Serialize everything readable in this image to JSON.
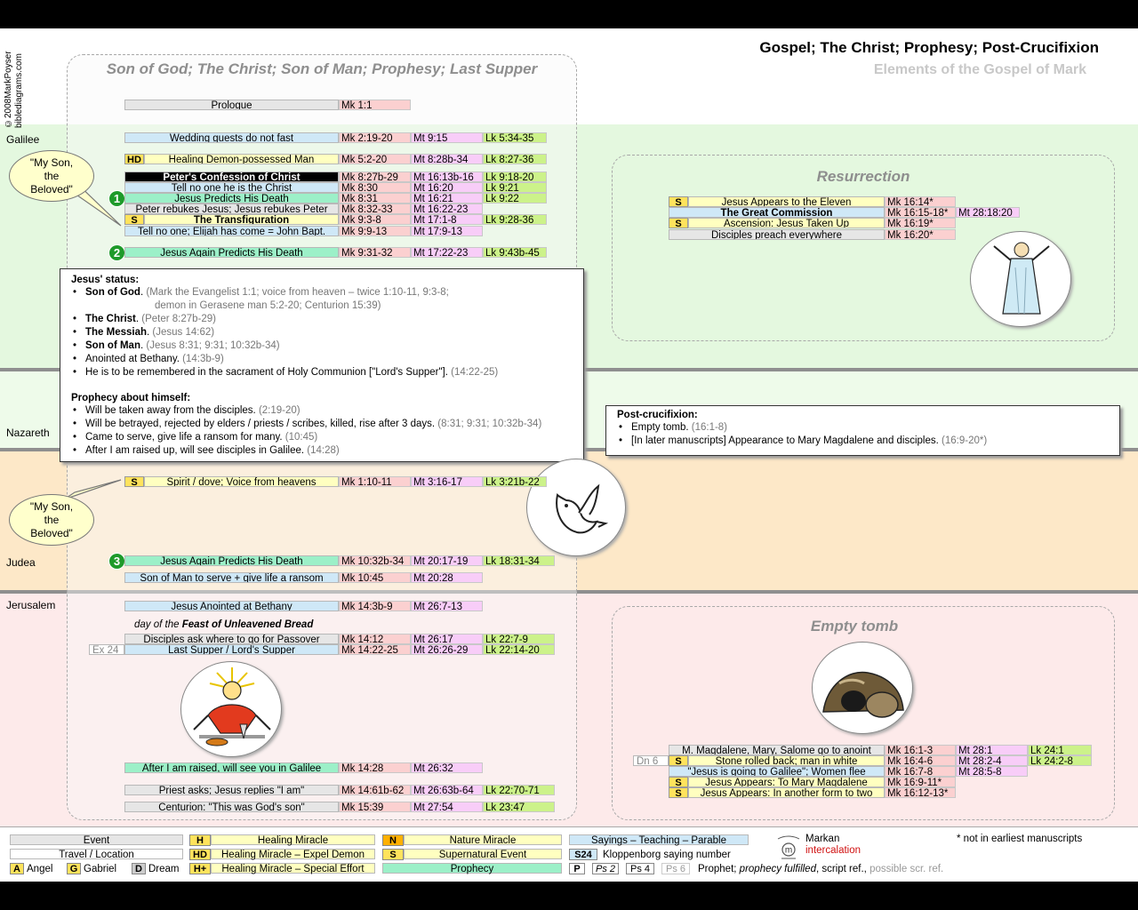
{
  "header": {
    "copyright": "©2008MarkPoyser\nbiblediagrams.com",
    "title": "Gospel; The Christ; Prophesy; Post-Crucifixion",
    "subtitle": "Elements of the Gospel of Mark"
  },
  "regions": {
    "galilee": "Galilee",
    "nazareth": "Nazareth",
    "judea": "Judea",
    "jerusalem": "Jerusalem"
  },
  "panels": {
    "main": "Son of God; The Christ; Son of Man; Prophesy; Last Supper",
    "resurrection": "Resurrection",
    "empty_tomb": "Empty tomb"
  },
  "bubbles": {
    "top": "\"My Son,\nthe\nBeloved\"",
    "bottom": "\"My Son,\nthe\nBeloved\""
  },
  "rows": {
    "prologue": {
      "label": "Prologue",
      "mk": "Mk 1:1"
    },
    "wedding": {
      "label": "Wedding guests do not fast",
      "mk": "Mk 2:19-20",
      "mt": "Mt 9:15",
      "lk": "Lk 5:34-35"
    },
    "healing": {
      "tag": "HD",
      "label": "Healing Demon-possessed Man",
      "mk": "Mk 5:2-20",
      "mt": "Mt 8:28b-34",
      "lk": "Lk 8:27-36"
    },
    "confession": {
      "label": "Peter's Confession of Christ",
      "mk": "Mk 8:27b-29",
      "mt": "Mt 16:13b-16",
      "lk": "Lk 9:18-20"
    },
    "tell_no_one": {
      "label": "Tell no one he is the Christ",
      "mk": "Mk 8:30",
      "mt": "Mt 16:20",
      "lk": "Lk 9:21"
    },
    "predicts1": {
      "num": "1",
      "label": "Jesus Predicts His Death",
      "mk": "Mk 8:31",
      "mt": "Mt 16:21",
      "lk": "Lk 9:22"
    },
    "rebukes": {
      "label": "Peter rebukes Jesus; Jesus rebukes Peter",
      "mk": "Mk 8:32-33",
      "mt": "Mt 16:22-23"
    },
    "transfig": {
      "tag": "S",
      "label": "The Transfiguration",
      "mk": "Mk 9:3-8",
      "mt": "Mt 17:1-8",
      "lk": "Lk 9:28-36"
    },
    "elijah": {
      "label": "Tell no one; Elijah has come = John Bapt.",
      "mk": "Mk 9:9-13",
      "mt": "Mt 17:9-13"
    },
    "predicts2": {
      "num": "2",
      "label": "Jesus Again Predicts His Death",
      "mk": "Mk 9:31-32",
      "mt": "Mt 17:22-23",
      "lk": "Lk 9:43b-45"
    },
    "spirit": {
      "tag": "S",
      "label": "Spirit / dove; Voice from heavens",
      "mk": "Mk 1:10-11",
      "mt": "Mt 3:16-17",
      "lk": "Lk 3:21b-22"
    },
    "predicts3": {
      "num": "3",
      "label": "Jesus Again Predicts His Death",
      "mk": "Mk 10:32b-34",
      "mt": "Mt 20:17-19",
      "lk": "Lk 18:31-34"
    },
    "serve": {
      "label": "Son of Man to serve + give life a ransom",
      "mk": "Mk 10:45",
      "mt": "Mt 20:28"
    },
    "anointed": {
      "label": "Jesus Anointed at Bethany",
      "mk": "Mk 14:3b-9",
      "mt": "Mt 26:7-13"
    },
    "feast": {
      "pre": "day of the ",
      "bold": "Feast of Unleavened Bread"
    },
    "passover": {
      "label": "Disciples ask where to go for Passover",
      "mk": "Mk 14:12",
      "mt": "Mt 26:17",
      "lk": "Lk 22:7-9"
    },
    "supper": {
      "ex": "Ex 24",
      "label": "Last Supper / Lord's Supper",
      "mk": "Mk 14:22-25",
      "mt": "Mt 26:26-29",
      "lk": "Lk 22:14-20"
    },
    "galilee_after": {
      "label": "After I am raised, will see you in Galilee",
      "mk": "Mk 14:28",
      "mt": "Mt 26:32"
    },
    "priest": {
      "label": "Priest asks; Jesus replies \"I am\"",
      "mk": "Mk 14:61b-62",
      "mt": "Mt 26:63b-64",
      "lk": "Lk 22:70-71"
    },
    "centurion": {
      "label": "Centurion: \"This was God's son\"",
      "mk": "Mk 15:39",
      "mt": "Mt 27:54",
      "lk": "Lk 23:47"
    },
    "eleven": {
      "tag": "S",
      "label": "Jesus Appears to the Eleven",
      "mk": "Mk 16:14*"
    },
    "commission": {
      "label": "The Great Commission",
      "mk": "Mk 16:15-18*",
      "mt": "Mt 28:18:20"
    },
    "ascension": {
      "tag": "S",
      "label": "Ascension: Jesus Taken Up",
      "mk": "Mk 16:19*"
    },
    "preach": {
      "label": "Disciples preach everywhere",
      "mk": "Mk 16:20*"
    },
    "magdalene": {
      "label": "M. Magdalene, Mary, Salome go to anoint",
      "mk": "Mk 16:1-3",
      "mt": "Mt 28:1",
      "lk": "Lk 24:1"
    },
    "stone": {
      "ex": "Dn 6",
      "tag": "S",
      "label": "Stone rolled back; man in white",
      "mk": "Mk 16:4-6",
      "mt": "Mt 28:2-4",
      "lk": "Lk 24:2-8"
    },
    "going": {
      "label": "\"Jesus is going to Galilee\"; Women flee",
      "mk": "Mk 16:7-8",
      "mt": "Mt 28:5-8"
    },
    "appears_mm": {
      "tag": "S",
      "label": "Jesus Appears: To Mary Magdalene",
      "mk": "Mk 16:9-11*"
    },
    "appears_two": {
      "tag": "S",
      "label": "Jesus Appears: In another form to two",
      "mk": "Mk 16:12-13*"
    }
  },
  "status_box": {
    "heading1": "Jesus' status:",
    "items1": [
      {
        "b": "Son of God",
        "t": ". ",
        "g": "(Mark the Evangelist 1:1; voice from heaven – twice 1:10-11, 9:3-8;",
        "g2": "demon in Gerasene man 5:2-20; Centurion 15:39)"
      },
      {
        "b": "The Christ",
        "t": ". ",
        "g": "(Peter 8:27b-29)"
      },
      {
        "b": "The Messiah",
        "t": ". ",
        "g": "(Jesus 14:62)"
      },
      {
        "b": "Son of Man",
        "t": ". ",
        "g": "(Jesus 8:31; 9:31; 10:32b-34)"
      },
      {
        "b": "",
        "t": "Anointed at Bethany. ",
        "g": "(14:3b-9)"
      },
      {
        "b": "",
        "t": "He is to be remembered in the sacrament of Holy Communion [\"Lord's Supper\"]. ",
        "g": "(14:22-25)"
      }
    ],
    "heading2": "Prophecy about himself:",
    "items2": [
      {
        "t": "Will be taken away from the disciples. ",
        "g": "(2:19-20)"
      },
      {
        "t": "Will be betrayed, rejected by elders / priests / scribes, killed, rise after 3 days. ",
        "g": "(8:31; 9:31; 10:32b-34)"
      },
      {
        "t": "Came to serve, give life a ransom for many. ",
        "g": "(10:45)"
      },
      {
        "t": "After I am raised up, will see disciples in Galilee. ",
        "g": "(14:28)"
      }
    ]
  },
  "post_box": {
    "heading": "Post-crucifixion:",
    "items": [
      {
        "t": "Empty tomb. ",
        "g": "(16:1-8)"
      },
      {
        "t": "[In later manuscripts] Appearance to Mary Magdalene and disciples. ",
        "g": "(16:9-20*)"
      }
    ]
  },
  "legend": {
    "event": "Event",
    "travel": "Travel / Location",
    "angel_tag": "A",
    "angel": "Angel",
    "gabriel_tag": "G",
    "gabriel": "Gabriel",
    "dream_tag": "D",
    "dream": "Dream",
    "h_tag": "H",
    "h": "Healing Miracle",
    "hd_tag": "HD",
    "hd": "Healing Miracle – Expel Demon",
    "hp_tag": "H+",
    "hp": "Healing Miracle – Special Effort",
    "n_tag": "N",
    "n": "Nature Miracle",
    "s_tag": "S",
    "s": "Supernatural Event",
    "prophecy": "Prophecy",
    "sayings": "Sayings – Teaching – Parable",
    "s24_tag": "S24",
    "s24": "Kloppenborg saying number",
    "p_tag": "P",
    "ps2": "Ps 2",
    "ps4": "Ps 4",
    "ps6": "Ps 6",
    "prophet": "Prophet; ",
    "fulfilled": "prophecy fulfilled",
    "script": ", script ref., ",
    "possible": "possible scr. ref.",
    "markan": "Markan",
    "intercalation": "intercalation",
    "note": "* not in earliest manuscripts"
  },
  "colors": {
    "galilee_band": "#e4f8df",
    "nazareth_band": "#eefbea",
    "judea_band": "#fde8c8",
    "jerusalem_band": "#fdeaea",
    "prophecy": "#9cf0c8",
    "mark": "#fbd0d0",
    "matthew": "#f8cdf8",
    "luke": "#ccf28a"
  }
}
